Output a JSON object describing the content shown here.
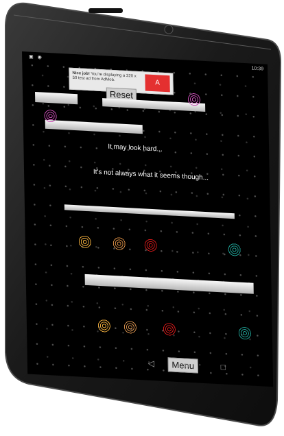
{
  "status": {
    "left_icons": "▣ ◉",
    "time": "10:39"
  },
  "ad": {
    "title": "Nice job!",
    "body": "You're displaying a 320 x 50 test ad from AdMob.",
    "logo": "A"
  },
  "game": {
    "reset_label": "Reset",
    "menu_label": "Menu",
    "hint_1": "It may look hard...",
    "hint_2": "It's not always what it seems though..."
  },
  "colors": {
    "magenta": "#c84db4",
    "orange": "#e4a53a",
    "red": "#cc1818",
    "teal": "#1e9c90",
    "brown": "#c98748"
  },
  "icons": {
    "back": "◁",
    "home": "○",
    "recent": "□"
  }
}
